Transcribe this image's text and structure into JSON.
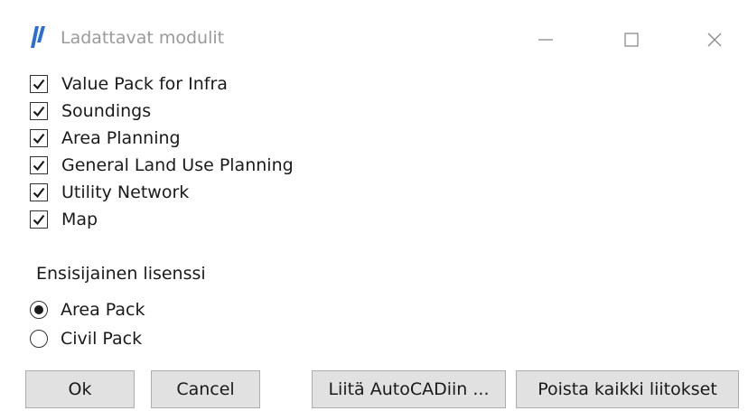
{
  "window": {
    "title": "Ladattavat modulit",
    "app_icon": "app-logo-icon",
    "controls": {
      "minimize_icon": "minimize-icon",
      "maximize_icon": "maximize-icon",
      "close_icon": "close-icon"
    }
  },
  "modules": [
    {
      "label": "Value Pack for Infra",
      "checked": true
    },
    {
      "label": "Soundings",
      "checked": true
    },
    {
      "label": "Area Planning",
      "checked": true
    },
    {
      "label": "General Land Use Planning",
      "checked": true
    },
    {
      "label": "Utility Network",
      "checked": true
    },
    {
      "label": "Map",
      "checked": true
    }
  ],
  "license": {
    "group_label": "Ensisijainen lisenssi",
    "options": [
      {
        "label": "Area Pack",
        "selected": true
      },
      {
        "label": "Civil Pack",
        "selected": false
      }
    ]
  },
  "buttons": {
    "ok": "Ok",
    "cancel": "Cancel",
    "attach": "Liitä AutoCADiin ...",
    "remove_all": "Poista kaikki liitokset"
  },
  "colors": {
    "accent_icon": "#2b6cd8",
    "button_face": "#e1e1e1",
    "title_text": "#9a9a9a"
  }
}
